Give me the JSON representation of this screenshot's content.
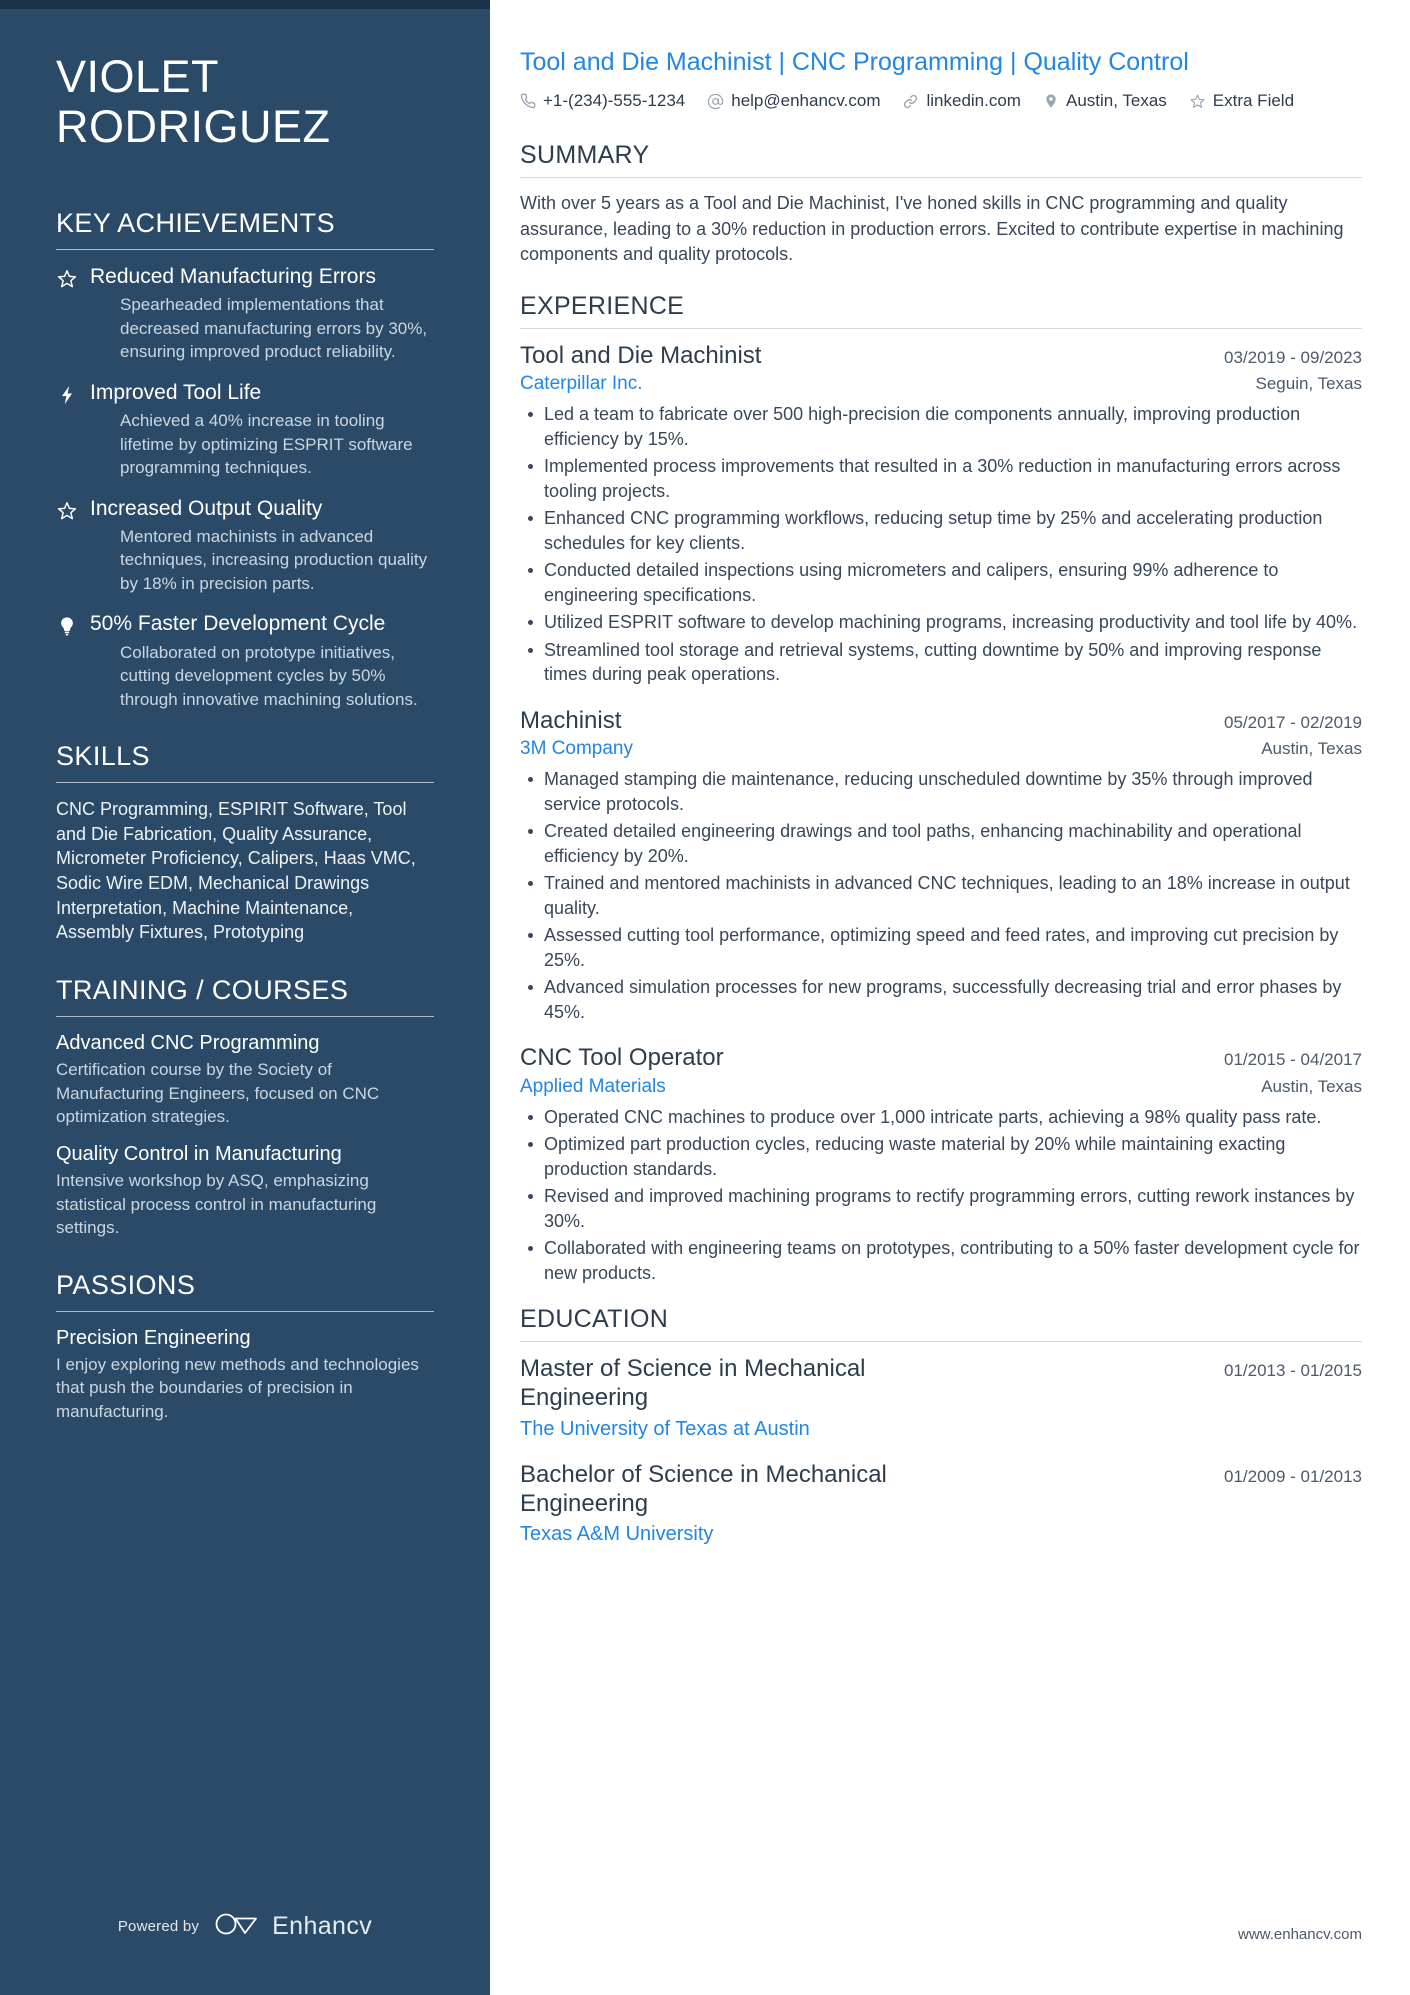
{
  "colors": {
    "sidebar_bg": "#2a4a68",
    "accent_link": "#2186e5",
    "body_text": "#39475a",
    "muted_text": "#4c5a6b"
  },
  "sidebar": {
    "name_lines": [
      "VIOLET",
      "RODRIGUEZ"
    ],
    "sections": {
      "key_achievements": {
        "title": "KEY ACHIEVEMENTS",
        "items": [
          {
            "icon": "star-icon",
            "title": "Reduced Manufacturing Errors",
            "description": "Spearheaded implementations that decreased manufacturing errors by 30%, ensuring improved product reliability."
          },
          {
            "icon": "lightning-bolt-icon",
            "title": "Improved Tool Life",
            "description": "Achieved a 40% increase in tooling lifetime by optimizing ESPRIT software programming techniques."
          },
          {
            "icon": "star-icon",
            "title": "Increased Output Quality",
            "description": "Mentored machinists in advanced techniques, increasing production quality by 18% in precision parts."
          },
          {
            "icon": "lightbulb-icon",
            "title": "50% Faster Development Cycle",
            "description": "Collaborated on prototype initiatives, cutting development cycles by 50% through innovative machining solutions."
          }
        ]
      },
      "skills": {
        "title": "SKILLS",
        "text": "CNC Programming, ESPIRIT Software, Tool and Die Fabrication, Quality Assurance, Micrometer Proficiency, Calipers, Haas VMC, Sodic Wire EDM, Mechanical Drawings Interpretation, Machine Maintenance, Assembly Fixtures, Prototyping"
      },
      "training": {
        "title": "TRAINING / COURSES",
        "items": [
          {
            "title": "Advanced CNC Programming",
            "description": "Certification course by the Society of Manufacturing Engineers, focused on CNC optimization strategies."
          },
          {
            "title": "Quality Control in Manufacturing",
            "description": "Intensive workshop by ASQ, emphasizing statistical process control in manufacturing settings."
          }
        ]
      },
      "passions": {
        "title": "PASSIONS",
        "items": [
          {
            "title": "Precision Engineering",
            "description": "I enjoy exploring new methods and technologies that push the boundaries of precision in manufacturing."
          }
        ]
      }
    },
    "footer": {
      "powered_by": "Powered by",
      "brand": "Enhancv"
    }
  },
  "main": {
    "headline": "Tool and Die Machinist | CNC Programming | Quality Control",
    "contacts": [
      {
        "icon": "phone-icon",
        "value": "+1-(234)-555-1234"
      },
      {
        "icon": "at-sign-icon",
        "value": "help@enhancv.com"
      },
      {
        "icon": "link-icon",
        "value": "linkedin.com"
      },
      {
        "icon": "location-pin-icon",
        "value": "Austin, Texas"
      },
      {
        "icon": "star-icon",
        "value": "Extra Field"
      }
    ],
    "summary": {
      "title": "SUMMARY",
      "text": "With over 5 years as a Tool and Die Machinist, I've honed skills in CNC programming and quality assurance, leading to a 30% reduction in production errors. Excited to contribute expertise in machining components and quality protocols."
    },
    "experience": {
      "title": "EXPERIENCE",
      "jobs": [
        {
          "title": "Tool and Die Machinist",
          "dates": "03/2019 - 09/2023",
          "company": "Caterpillar Inc.",
          "location": "Seguin, Texas",
          "bullets": [
            "Led a team to fabricate over 500 high-precision die components annually, improving production efficiency by 15%.",
            "Implemented process improvements that resulted in a 30% reduction in manufacturing errors across tooling projects.",
            "Enhanced CNC programming workflows, reducing setup time by 25% and accelerating production schedules for key clients.",
            "Conducted detailed inspections using micrometers and calipers, ensuring 99% adherence to engineering specifications.",
            "Utilized ESPRIT software to develop machining programs, increasing productivity and tool life by 40%.",
            "Streamlined tool storage and retrieval systems, cutting downtime by 50% and improving response times during peak operations."
          ]
        },
        {
          "title": "Machinist",
          "dates": "05/2017 - 02/2019",
          "company": "3M Company",
          "location": "Austin, Texas",
          "bullets": [
            "Managed stamping die maintenance, reducing unscheduled downtime by 35% through improved service protocols.",
            "Created detailed engineering drawings and tool paths, enhancing machinability and operational efficiency by 20%.",
            "Trained and mentored machinists in advanced CNC techniques, leading to an 18% increase in output quality.",
            "Assessed cutting tool performance, optimizing speed and feed rates, and improving cut precision by 25%.",
            "Advanced simulation processes for new programs, successfully decreasing trial and error phases by 45%."
          ]
        },
        {
          "title": "CNC Tool Operator",
          "dates": "01/2015 - 04/2017",
          "company": "Applied Materials",
          "location": "Austin, Texas",
          "bullets": [
            "Operated CNC machines to produce over 1,000 intricate parts, achieving a 98% quality pass rate.",
            "Optimized part production cycles, reducing waste material by 20% while maintaining exacting production standards.",
            "Revised and improved machining programs to rectify programming errors, cutting rework instances by 30%.",
            "Collaborated with engineering teams on prototypes, contributing to a 50% faster development cycle for new products."
          ]
        }
      ]
    },
    "education": {
      "title": "EDUCATION",
      "entries": [
        {
          "degree": "Master of Science in Mechanical Engineering",
          "dates": "01/2013 - 01/2015",
          "school": "The University of Texas at Austin"
        },
        {
          "degree": "Bachelor of Science in Mechanical Engineering",
          "dates": "01/2009 - 01/2013",
          "school": "Texas A&M University"
        }
      ]
    },
    "footer_url": "www.enhancv.com"
  }
}
